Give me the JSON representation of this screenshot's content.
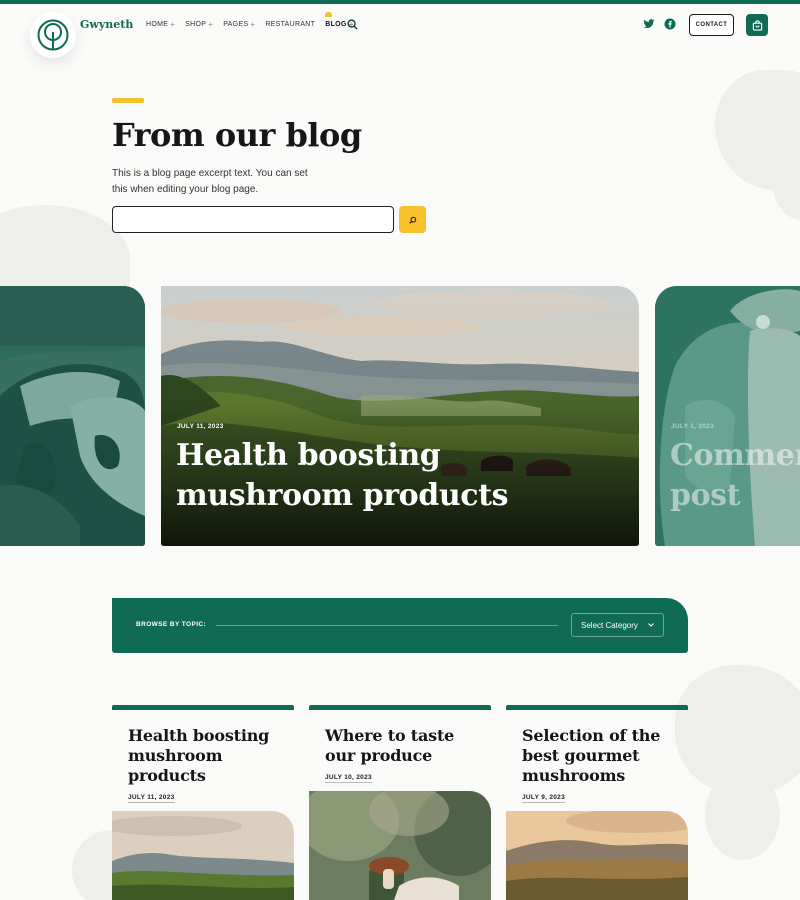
{
  "header": {
    "brand": "Gwyneth",
    "nav": [
      {
        "label": "HOME",
        "plus": "+"
      },
      {
        "label": "SHOP",
        "plus": "+"
      },
      {
        "label": "PAGES",
        "plus": "+"
      },
      {
        "label": "RESTAURANT",
        "plus": ""
      },
      {
        "label": "BLOG",
        "plus": "+"
      }
    ],
    "contact_label": "CONTACT"
  },
  "hero": {
    "title": "From our blog",
    "excerpt": "This is a blog page excerpt text. You can set this when editing your blog page.",
    "search_value": ""
  },
  "carousel": {
    "main": {
      "date": "JULY 11, 2023",
      "title": "Health boosting mushroom products"
    },
    "next": {
      "date": "JULY 1, 2023",
      "title": "Comment post"
    }
  },
  "topics": {
    "label": "BROWSE BY TOPIC:",
    "select_value": "Select Category"
  },
  "posts": [
    {
      "title": "Health boosting mushroom products",
      "date": "JULY 11, 2023"
    },
    {
      "title": "Where to taste our produce",
      "date": "JULY 10, 2023"
    },
    {
      "title": "Selection of the best gourmet mushrooms",
      "date": "JULY 9, 2023"
    }
  ],
  "colors": {
    "brand_green": "#0f6b53",
    "accent_yellow": "#f6c12a"
  },
  "icons": [
    "tree-logo-icon",
    "search-icon",
    "twitter-icon",
    "facebook-icon",
    "shopping-bag-icon",
    "chevron-down-icon"
  ]
}
